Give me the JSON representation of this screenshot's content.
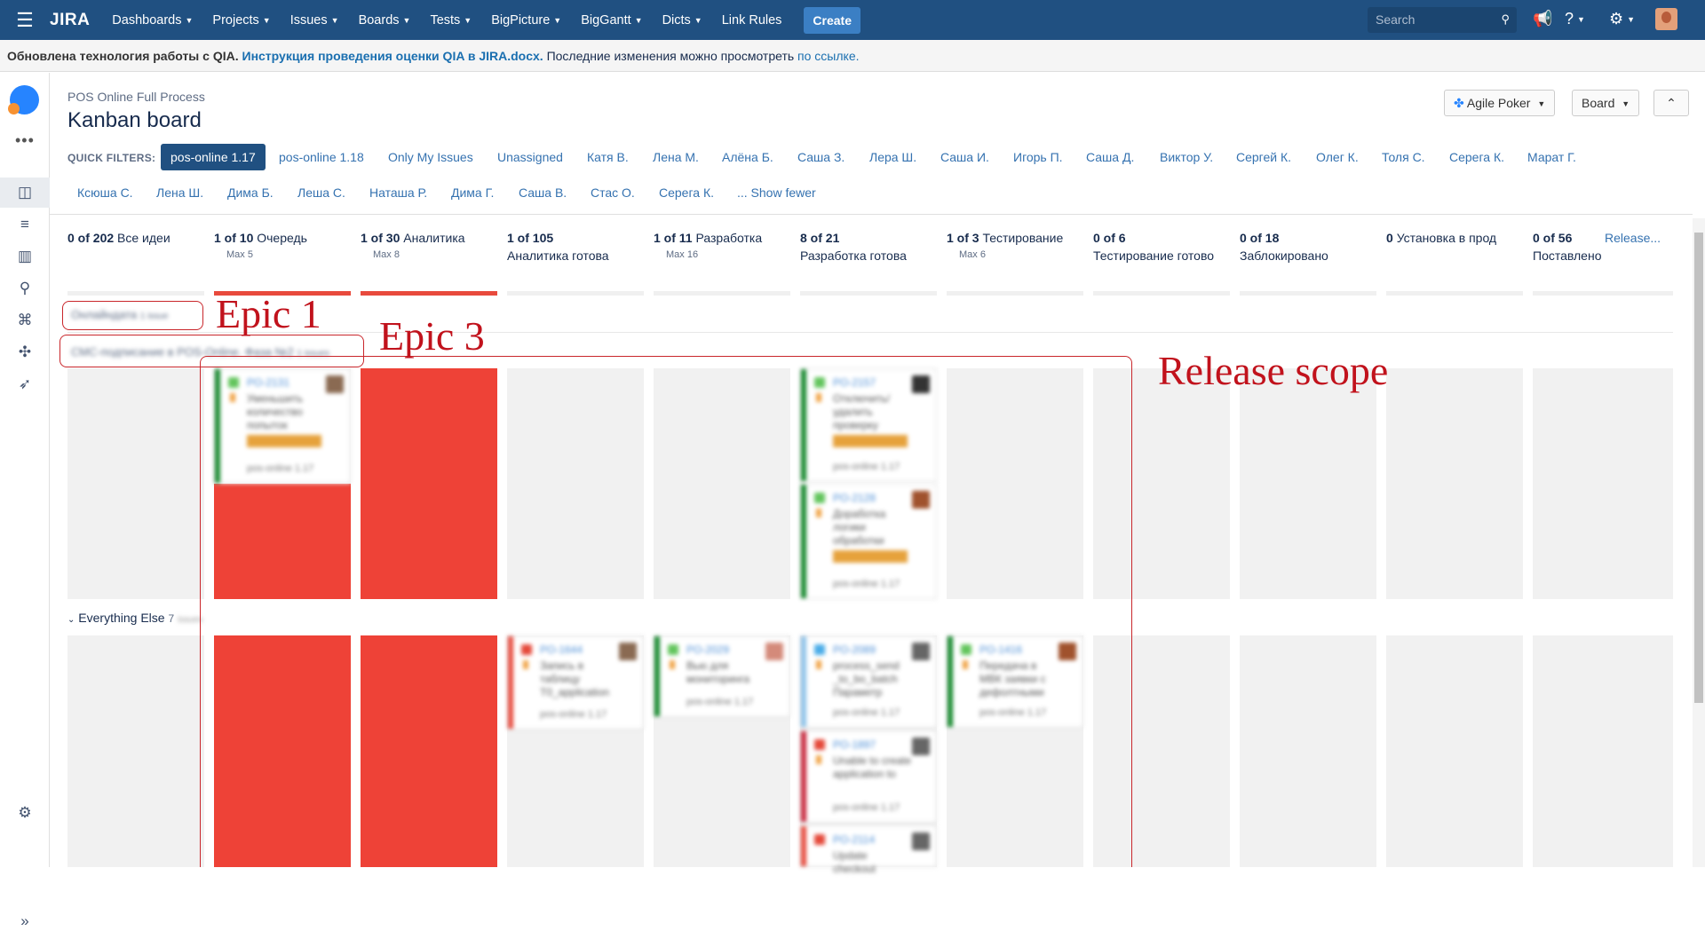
{
  "topnav": {
    "logo": "JIRA",
    "menus": [
      "Dashboards",
      "Projects",
      "Issues",
      "Boards",
      "Tests",
      "BigPicture",
      "BigGantt",
      "Dicts"
    ],
    "link_rules": "Link Rules",
    "create": "Create",
    "search_placeholder": "Search"
  },
  "banner": {
    "part1": "Обновлена технология работы с QIA.",
    "link1": "Инструкция проведения оценки QIA в JIRA.docx.",
    "part2": "Последние изменения можно просмотреть",
    "link2": "по ссылке."
  },
  "board": {
    "project": "POS Online Full Process",
    "title": "Kanban board",
    "agile_poker": "Agile Poker",
    "board_btn": "Board",
    "quick_filters_label": "QUICK FILTERS:",
    "filters_row1": [
      "pos-online 1.17",
      "pos-online 1.18",
      "Only My Issues",
      "Unassigned",
      "Катя В.",
      "Лена М.",
      "Алёна Б.",
      "Саша З.",
      "Лера Ш.",
      "Саша И.",
      "Игорь П.",
      "Саша Д.",
      "Виктор У.",
      "Сергей К.",
      "Олег К.",
      "Толя С.",
      "Серега К.",
      "Марат Г."
    ],
    "filters_row2": [
      "Ксюша С.",
      "Лена Ш.",
      "Дима Б.",
      "Леша С.",
      "Наташа Р.",
      "Дима Г.",
      "Саша В.",
      "Стас О.",
      "Серега К.",
      "... Show fewer"
    ]
  },
  "columns": [
    {
      "count": "0 of 202",
      "name": "Все идеи",
      "max": ""
    },
    {
      "count": "1 of 10",
      "name": "Очередь",
      "max": "Max 5"
    },
    {
      "count": "1 of 30",
      "name": "Аналитика",
      "max": "Max 8"
    },
    {
      "count": "1 of 105",
      "name": "Аналитика готова",
      "max": ""
    },
    {
      "count": "1 of 11",
      "name": "Разработка",
      "max": "Max 16"
    },
    {
      "count": "8 of 21",
      "name": "Разработка готова",
      "max": ""
    },
    {
      "count": "1 of 3",
      "name": "Тестирование",
      "max": "Max 6"
    },
    {
      "count": "0 of 6",
      "name": "Тестирование готово",
      "max": ""
    },
    {
      "count": "0 of 18",
      "name": "Заблокировано",
      "max": ""
    },
    {
      "count": "0",
      "name": "Установка в прод",
      "max": ""
    },
    {
      "count": "0 of 56",
      "name": "Поставлено",
      "max": ""
    }
  ],
  "release_link": "Release...",
  "swimlanes": {
    "lane1": "Онлайндата",
    "lane1_count": "1 issue",
    "lane2": "СМС-подписание в POS-Online. Фаза №2",
    "lane2_count": "1 issues",
    "lane3": "Everything Else",
    "lane3_count": "7",
    "lane3_suffix": "issues"
  },
  "cards": {
    "c1": {
      "key": "PO-2131",
      "summary": "Уменьшить количество попыток",
      "version": "pos-online 1.17"
    },
    "c2": {
      "key": "PO-2157",
      "summary": "Отключить/ удалить проверку",
      "version": "pos-online 1.17"
    },
    "c3": {
      "key": "PO-2128",
      "summary": "Доработка логики обработки",
      "version": "pos-online 1.17"
    },
    "c4": {
      "key": "PO-1644",
      "summary": "Запись в таблицу T0_application",
      "version": "pos-online 1.17"
    },
    "c5": {
      "key": "PO-2029",
      "summary": "Вью для мониторинга",
      "version": "pos-online 1.17"
    },
    "c6": {
      "key": "PO-2089",
      "summary": "process_send _to_bo_batch Параметр",
      "version": "pos-online 1.17"
    },
    "c7": {
      "key": "PO-1416",
      "summary": "Передача в МВК заявки с дефолтными",
      "version": "pos-online 1.17"
    },
    "c8": {
      "key": "PO-1897",
      "summary": "Unable to create application to",
      "version": "pos-online 1.17"
    },
    "c9": {
      "key": "PO-2114",
      "summary": "Update checkout",
      "version": ""
    }
  },
  "annotations": {
    "epic1": "Epic 1",
    "epic3": "Epic 3",
    "release_scope": "Release scope"
  },
  "colors": {
    "nav": "#205081",
    "accent": "#3b7fc4",
    "wip_over": "#e84a3d",
    "block": "#ee4237",
    "annotation": "#c1121c"
  }
}
